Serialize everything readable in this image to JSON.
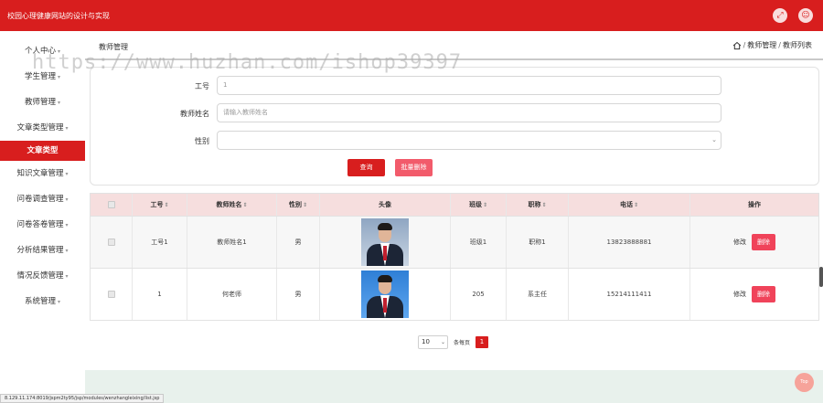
{
  "app": {
    "title": "校园心理健康网站的设计与实现"
  },
  "topbar": {
    "fullscreen_icon": "expand-icon",
    "user_icon": "user-icon"
  },
  "sidebar": {
    "items": [
      {
        "label": "个人中心",
        "caret": "▾"
      },
      {
        "label": "学生管理",
        "caret": "▾"
      },
      {
        "label": "教师管理",
        "caret": "▾"
      },
      {
        "label": "文章类型管理",
        "caret": "▾"
      },
      {
        "label": "文章类型",
        "caret": ""
      },
      {
        "label": "知识文章管理",
        "caret": "▾"
      },
      {
        "label": "问卷调查管理",
        "caret": "▾"
      },
      {
        "label": "问卷答卷管理",
        "caret": "▾"
      },
      {
        "label": "分析结果管理",
        "caret": "▾"
      },
      {
        "label": "情况反馈管理",
        "caret": "▾"
      },
      {
        "label": "系统管理",
        "caret": "▾"
      }
    ],
    "active_index": 4
  },
  "breadcrumb": {
    "page_title": "教师管理",
    "home_icon": "home-icon",
    "crumb1": "教师管理",
    "sep": "/",
    "crumb2": "教师列表"
  },
  "watermark": "https://www.huzhan.com/ishop39397",
  "search": {
    "fields": [
      {
        "label": "工号",
        "value": "1",
        "placeholder": ""
      },
      {
        "label": "教师姓名",
        "value": "",
        "placeholder": "请输入教师姓名"
      },
      {
        "label": "性别",
        "value": "",
        "placeholder": ""
      }
    ],
    "query_label": "查询",
    "batch_delete_label": "批量删除"
  },
  "table": {
    "headers": [
      "",
      "工号",
      "教师姓名",
      "性别",
      "头像",
      "班级",
      "职称",
      "电话",
      "操作"
    ],
    "sortable": [
      false,
      true,
      true,
      true,
      false,
      true,
      true,
      true,
      false
    ],
    "sort_glyph": "⇕",
    "rows": [
      {
        "gonghao": "工号1",
        "name": "教师姓名1",
        "gender": "男",
        "banji": "班级1",
        "zhicheng": "职称1",
        "phone": "13823888881"
      },
      {
        "gonghao": "1",
        "name": "何老师",
        "gender": "男",
        "banji": "205",
        "zhicheng": "系主任",
        "phone": "15214111411"
      }
    ],
    "edit_label": "修改",
    "delete_label": "删除"
  },
  "pagination": {
    "page_size": "10",
    "per_page_label": "条每页",
    "current_page": "1"
  },
  "statusbar": "8.129.11.174:8019/jspm2ty95/jsp/modules/wenzhangleixing/list.jsp",
  "back_to_top": "Top",
  "colors": {
    "primary": "#d81e1e",
    "danger": "#f0435a",
    "header_row": "#f6dede"
  }
}
